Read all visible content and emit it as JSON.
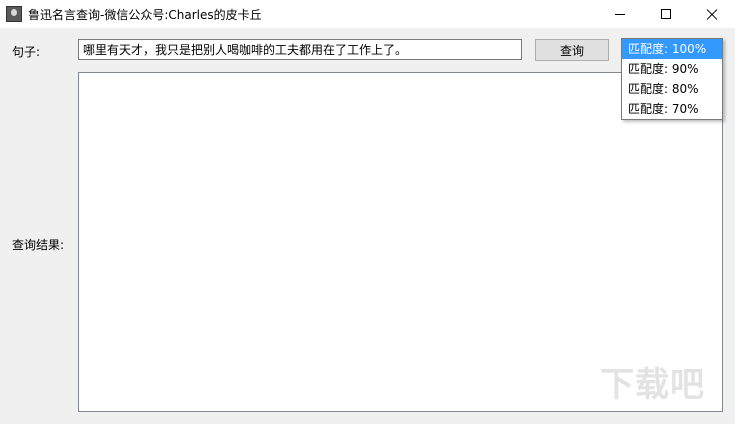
{
  "window": {
    "title": "鲁迅名言查询-微信公众号:Charles的皮卡丘",
    "icon": "app-portrait-icon"
  },
  "form": {
    "sentence_label": "句子:",
    "sentence_value": "哪里有天才，我只是把别人喝咖啡的工夫都用在了工作上了。",
    "query_button_label": "查询",
    "result_label": "查询结果:",
    "result_value": ""
  },
  "match_dropdown": {
    "selected_index": 0,
    "options": [
      "匹配度: 100%",
      "匹配度: 90%",
      "匹配度: 80%",
      "匹配度: 70%"
    ]
  },
  "watermark": {
    "text": "下载吧"
  },
  "colors": {
    "selection": "#3399ff",
    "window_bg": "#f0f0f0",
    "titlebar_bg": "#ffffff"
  }
}
